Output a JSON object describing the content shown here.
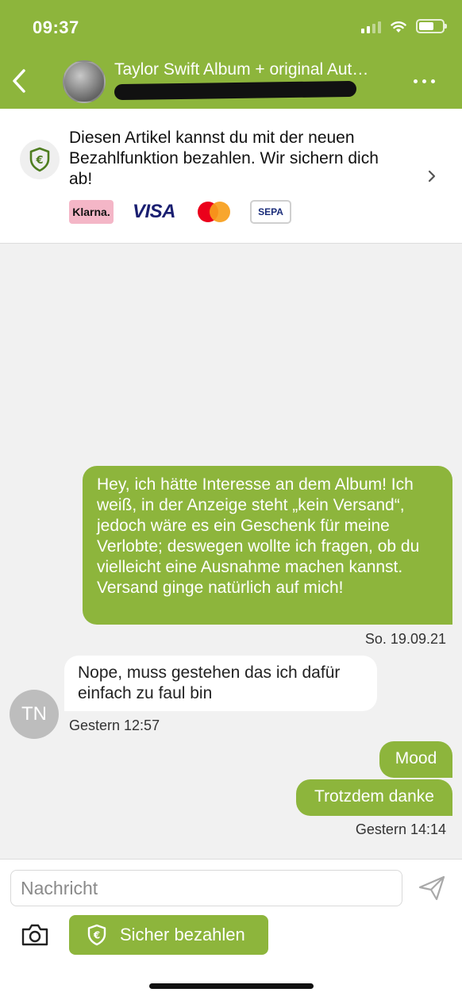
{
  "status_bar": {
    "time": "09:37",
    "signal_icon": "cellular-signal-icon",
    "wifi_icon": "wifi-icon",
    "battery_icon": "battery-icon"
  },
  "header": {
    "title": "Taylor Swift Album + original Aut…",
    "back_icon": "chevron-left-icon",
    "more_icon": "more-horizontal-icon"
  },
  "payment_banner": {
    "text": "Diesen Artikel kannst du mit der neuen Bezahlfunktion bezahlen. Wir sichern dich ab!",
    "shield_icon": "euro-shield-icon",
    "logos": {
      "klarna": "Klarna.",
      "visa": "VISA",
      "sepa": "SEPA"
    }
  },
  "messages": [
    {
      "direction": "outgoing",
      "text": "Hey, ich hätte Interesse an dem Album! Ich weiß, in der Anzeige steht „kein Versand“, jedoch wäre es ein Geschenk für meine Verlobte; deswegen wollte ich fragen, ob du vielleicht eine Ausnahme machen kannst. Versand ginge natürlich auf mich!",
      "timestamp": "So. 19.09.21"
    },
    {
      "direction": "incoming",
      "sender_initials": "TN",
      "text": "Nope, muss gestehen das ich dafür einfach zu faul bin",
      "timestamp": "Gestern 12:57"
    },
    {
      "direction": "outgoing",
      "text": "Mood"
    },
    {
      "direction": "outgoing",
      "text": "Trotzdem danke",
      "timestamp": "Gestern 14:14"
    }
  ],
  "composer": {
    "placeholder": "Nachricht",
    "pay_button": "Sicher bezahlen",
    "send_icon": "send-icon",
    "camera_icon": "camera-icon"
  },
  "colors": {
    "brand": "#8db53c",
    "background": "#f1f1f1"
  }
}
